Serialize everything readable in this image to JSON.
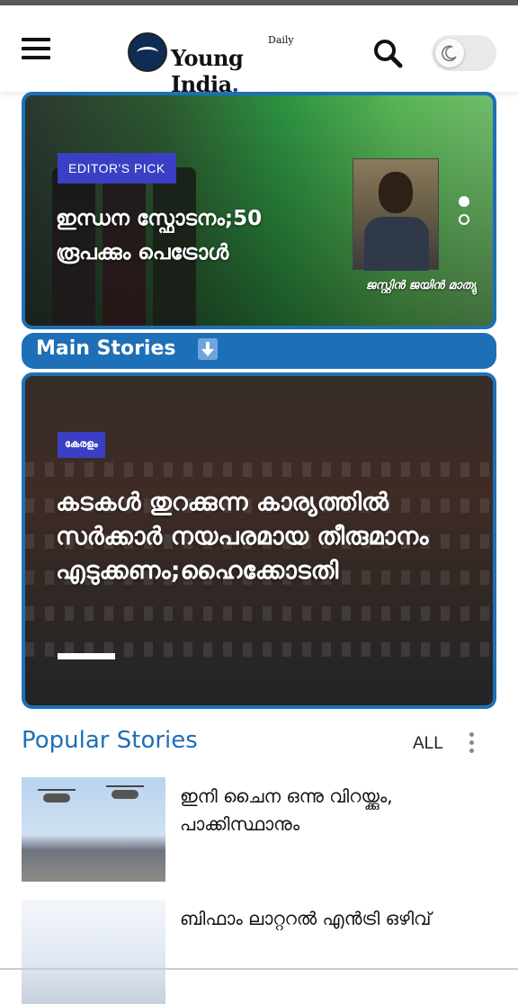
{
  "header": {
    "logo_daily": "Daily",
    "logo_text": "Young India",
    "logo_dot": "."
  },
  "editors_pick": {
    "badge": "EDITOR'S PICK",
    "headline": "ഇന്ധന സ്ഫോടനം;50 രൂപക്കും പെട്രോൾ",
    "byline": "ജസ്റ്റിൻ ജയിൻ മാത്യു"
  },
  "main_stories": {
    "label": "Main Stories"
  },
  "lead_story": {
    "badge": "കേരളം",
    "headline": "കടകൾ തുറക്കുന്ന കാര്യത്തിൽ സർക്കാർ നയപരമായ തീരുമാനം എടുക്കണം;ഹൈക്കോടതി"
  },
  "popular": {
    "title": "Popular Stories",
    "all_label": "ALL",
    "stories": [
      {
        "title": "ഇനി ചൈന ഒന്നു വിറയ്ക്കും, പാക്കിസ്ഥാനും"
      },
      {
        "title": "ബിഫാം ലാറ്ററൽ എൻട്രി ഒഴിവ്"
      }
    ]
  },
  "colors": {
    "accent": "#1d6fb8",
    "badge": "#3a3fc4"
  }
}
